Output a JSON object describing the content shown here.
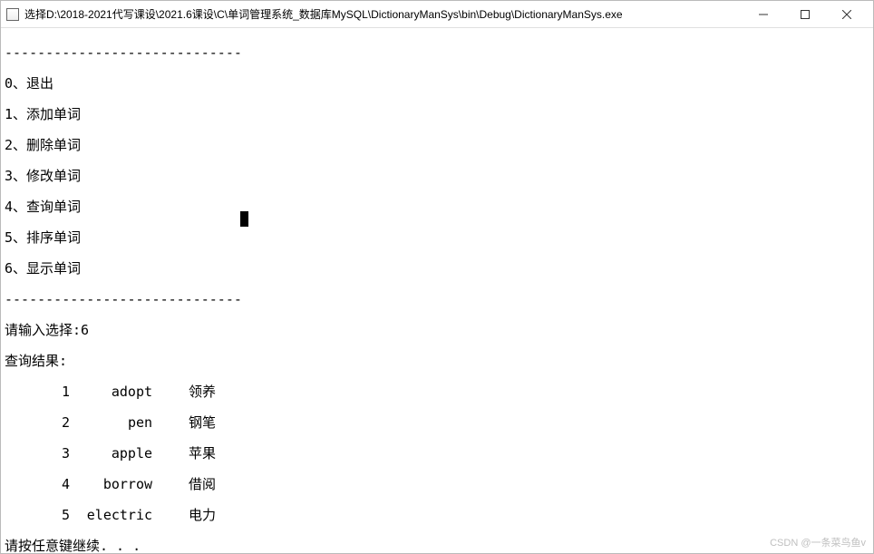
{
  "window": {
    "title": "选择D:\\2018-2021代写课设\\2021.6课设\\C\\单词管理系统_数据库MySQL\\DictionaryManSys\\bin\\Debug\\DictionaryManSys.exe"
  },
  "divider": "-----------------------------",
  "menu": {
    "items": [
      "0、退出",
      "1、添加单词",
      "2、删除单词",
      "3、修改单词",
      "4、查询单词",
      "5、排序单词",
      "6、显示单词"
    ]
  },
  "prompt": {
    "label": "请输入选择:",
    "value": "6"
  },
  "result": {
    "header": "查询结果:",
    "rows": [
      {
        "id": "1",
        "en": "adopt",
        "cn": "领养"
      },
      {
        "id": "2",
        "en": "pen",
        "cn": "钢笔"
      },
      {
        "id": "3",
        "en": "apple",
        "cn": "苹果"
      },
      {
        "id": "4",
        "en": "borrow",
        "cn": "借阅"
      },
      {
        "id": "5",
        "en": "electric",
        "cn": "电力"
      }
    ]
  },
  "footer": "请按任意键继续. . .",
  "watermark": "CSDN @一条菜鸟鱼v"
}
